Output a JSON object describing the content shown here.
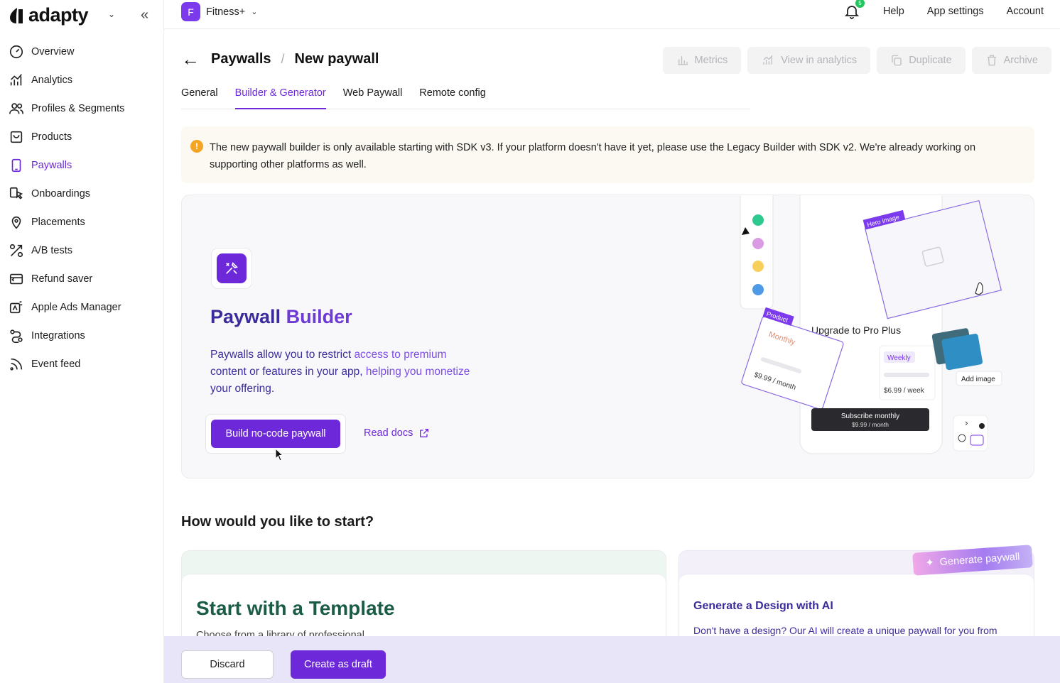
{
  "brand": {
    "name": "adapty",
    "accent": "#6d28d9"
  },
  "sidebar": {
    "items": [
      {
        "label": "Overview",
        "icon": "gauge-icon"
      },
      {
        "label": "Analytics",
        "icon": "analytics-icon"
      },
      {
        "label": "Profiles & Segments",
        "icon": "users-icon"
      },
      {
        "label": "Products",
        "icon": "product-box-icon"
      },
      {
        "label": "Paywalls",
        "icon": "phone-icon",
        "active": true
      },
      {
        "label": "Onboardings",
        "icon": "onboarding-icon"
      },
      {
        "label": "Placements",
        "icon": "location-pin-icon"
      },
      {
        "label": "A/B tests",
        "icon": "ab-test-icon"
      },
      {
        "label": "Refund saver",
        "icon": "refund-icon"
      },
      {
        "label": "Apple Ads Manager",
        "icon": "ads-icon"
      },
      {
        "label": "Integrations",
        "icon": "integration-icon"
      },
      {
        "label": "Event feed",
        "icon": "rss-icon"
      }
    ]
  },
  "topbar": {
    "app_initial": "F",
    "app_name": "Fitness+",
    "notification_count": "5",
    "help": "Help",
    "app_settings": "App settings",
    "account": "Account"
  },
  "header": {
    "crumb_parent": "Paywalls",
    "separator": "/",
    "crumb_current": "New paywall",
    "actions": {
      "metrics": "Metrics",
      "analytics": "View in analytics",
      "duplicate": "Duplicate",
      "archive": "Archive"
    }
  },
  "tabs": [
    {
      "label": "General"
    },
    {
      "label": "Builder & Generator",
      "active": true
    },
    {
      "label": "Web Paywall"
    },
    {
      "label": "Remote config"
    }
  ],
  "notice": {
    "text": "The new paywall builder is only available starting with SDK v3. If your platform doesn't have it yet, please use the Legacy Builder with SDK v2. We're already working on supporting other platforms as well."
  },
  "hero": {
    "title_part1": "Paywall ",
    "title_part2": "Builder",
    "desc_1": "Paywalls allow you to restrict ",
    "desc_2": "access to premium",
    "desc_3": " content or features in your app, ",
    "desc_4": "helping you monetize",
    "desc_5": " your offering.",
    "primary_button": "Build no-code paywall",
    "read_docs": "Read docs",
    "illustration": {
      "hero_image_tag": "Hero image",
      "product_tag": "Product",
      "monthly": "Monthly",
      "monthly_price": "$9.99 / month",
      "upgrade_title": "Upgrade to Pro Plus",
      "weekly": "Weekly",
      "weekly_price": "$6.99 / week",
      "subscribe_title": "Subscribe monthly",
      "subscribe_price": "$9.99 / month",
      "add_image": "Add image",
      "swatches": [
        "#2dc98f",
        "#d99be3",
        "#f8cf5b",
        "#4f9ae6"
      ]
    }
  },
  "start": {
    "title": "How would you like to start?",
    "template_card": {
      "title": "Start with a Template",
      "subtitle": "Choose from a library of professional..."
    },
    "ai_card": {
      "tag": "Generate paywall",
      "title": "Generate a Design with AI",
      "subtitle": "Don't have a design? Our AI will create a unique paywall for you from scratch."
    }
  },
  "footer": {
    "discard": "Discard",
    "create": "Create as draft"
  }
}
